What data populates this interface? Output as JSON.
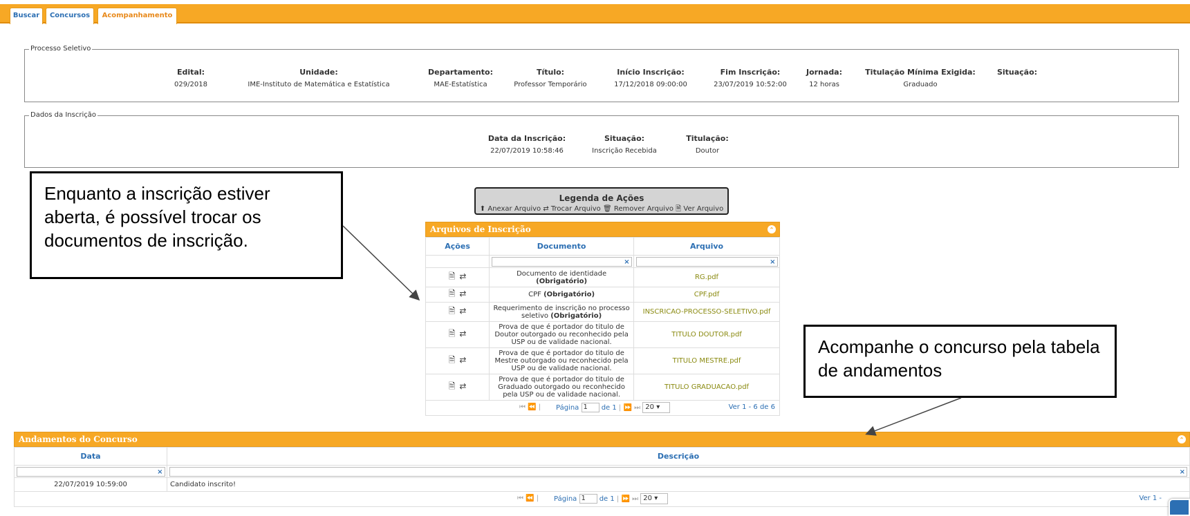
{
  "tabs": [
    "Buscar",
    "Concursos",
    "Acompanhamento"
  ],
  "processo": {
    "legend": "Processo Seletivo",
    "columns": [
      {
        "label": "Edital:",
        "value": "029/2018"
      },
      {
        "label": "Unidade:",
        "value": "IME-Instituto de Matemática e Estatística"
      },
      {
        "label": "Departamento:",
        "value": "MAE-Estatística"
      },
      {
        "label": "Título:",
        "value": "Professor Temporário"
      },
      {
        "label": "Início Inscrição:",
        "value": "17/12/2018 09:00:00"
      },
      {
        "label": "Fim Inscrição:",
        "value": "23/07/2019 10:52:00"
      },
      {
        "label": "Jornada:",
        "value": "12 horas"
      },
      {
        "label": "Titulação Mínima Exigida:",
        "value": "Graduado"
      },
      {
        "label": "Situação:",
        "value": ""
      }
    ]
  },
  "dados": {
    "legend": "Dados da Inscrição",
    "columns": [
      {
        "label": "Data da Inscrição:",
        "value": "22/07/2019 10:58:46"
      },
      {
        "label": "Situação:",
        "value": "Inscrição Recebida"
      },
      {
        "label": "Titulação:",
        "value": "Doutor"
      }
    ]
  },
  "callouts": {
    "left": "Enquanto a inscrição estiver aberta, é possível trocar os documentos de inscrição.",
    "right": "Acompanhe o concurso pela tabela de andamentos"
  },
  "legenda": {
    "title": "Legenda de Ações",
    "anexar": "Anexar Arquivo",
    "trocar": "Trocar Arquivo",
    "remover": "Remover Arquivo",
    "ver": "Ver Arquivo"
  },
  "arquivos": {
    "title": "Arquivos de Inscrição",
    "headers": [
      "Ações",
      "Documento",
      "Arquivo"
    ],
    "rows": [
      {
        "doc": "Documento de identidade",
        "req": "(Obrigatório)",
        "file": "RG.pdf"
      },
      {
        "doc": "CPF",
        "req": "(Obrigatório)",
        "file": "CPF.pdf"
      },
      {
        "doc": "Requerimento de inscrição no processo seletivo",
        "req": "(Obrigatório)",
        "file": "INSCRICAO-PROCESSO-SELETIVO.pdf"
      },
      {
        "doc": "Prova de que é portador do titulo de Doutor outorgado ou reconhecido pela USP ou de validade nacional.",
        "req": "",
        "file": "TITULO DOUTOR.pdf"
      },
      {
        "doc": "Prova de que é portador do titulo de Mestre outorgado ou reconhecido pela USP ou de validade nacional.",
        "req": "",
        "file": "TITULO MESTRE.pdf"
      },
      {
        "doc": "Prova de que é portador do titulo de Graduado outorgado ou reconhecido pela USP ou de validade nacional.",
        "req": "",
        "file": "TITULO GRADUACAO.pdf"
      }
    ],
    "pager": {
      "page_label": "Página",
      "page": "1",
      "of": "de 1",
      "size": "20",
      "range": "Ver 1 - 6 de 6"
    }
  },
  "andamentos": {
    "title": "Andamentos do Concurso",
    "headers": [
      "Data",
      "Descrição"
    ],
    "rows": [
      {
        "data": "22/07/2019 10:59:00",
        "desc": "Candidato inscrito!"
      }
    ],
    "pager": {
      "page_label": "Página",
      "page": "1",
      "of": "de 1",
      "size": "20",
      "range": "Ver 1 -"
    }
  }
}
